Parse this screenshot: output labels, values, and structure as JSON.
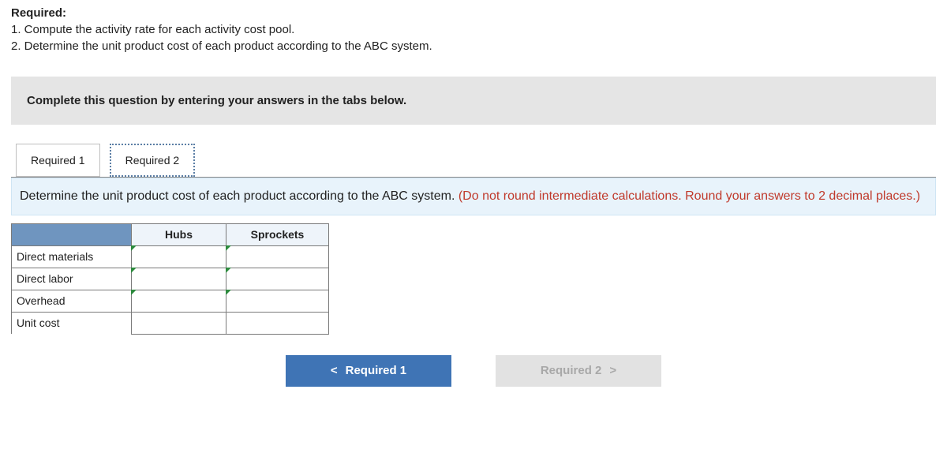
{
  "header": {
    "required_label": "Required:",
    "item1": "1. Compute the activity rate for each activity cost pool.",
    "item2": "2. Determine the unit product cost of each product according to the ABC system."
  },
  "banner": {
    "text": "Complete this question by entering your answers in the tabs below."
  },
  "tabs": {
    "tab1": "Required 1",
    "tab2": "Required 2"
  },
  "instruction": {
    "main": "Determine the unit product cost of each product according to the ABC system. ",
    "hint": "(Do not round intermediate calculations. Round your answers to 2 decimal places.)"
  },
  "table": {
    "col_hubs": "Hubs",
    "col_sprockets": "Sprockets",
    "rows": {
      "direct_materials": "Direct materials",
      "direct_labor": "Direct labor",
      "overhead": "Overhead",
      "unit_cost": "Unit cost"
    }
  },
  "nav": {
    "prev_chev": "<",
    "prev_label": "Required 1",
    "next_label": "Required 2",
    "next_chev": ">"
  }
}
